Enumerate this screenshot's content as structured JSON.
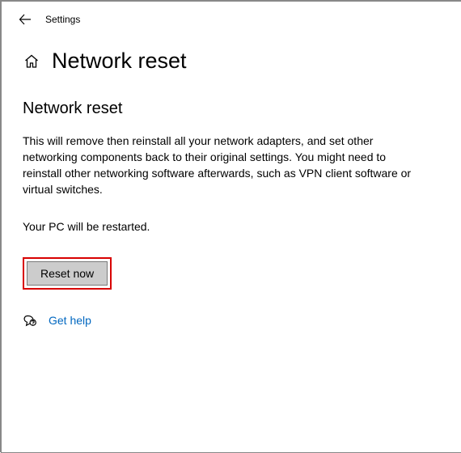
{
  "app_name": "Settings",
  "page_title": "Network reset",
  "section_heading": "Network reset",
  "description": "This will remove then reinstall all your network adapters, and set other networking components back to their original settings. You might need to reinstall other networking software afterwards, such as VPN client software or virtual switches.",
  "restart_notice": "Your PC will be restarted.",
  "reset_button": "Reset now",
  "help_link": "Get help"
}
